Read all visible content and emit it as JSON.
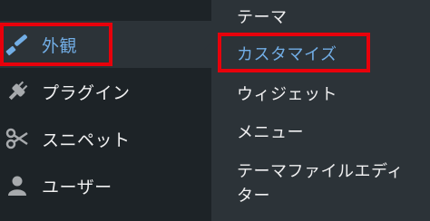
{
  "sidebar": {
    "items": [
      {
        "label": "外観",
        "icon": "paintbrush-icon",
        "active": true
      },
      {
        "label": "プラグイン",
        "icon": "plug-icon"
      },
      {
        "label": "スニペット",
        "icon": "scissors-icon"
      },
      {
        "label": "ユーザー",
        "icon": "user-icon"
      }
    ]
  },
  "submenu": {
    "items": [
      {
        "label": "テーマ"
      },
      {
        "label": "カスタマイズ",
        "current": true
      },
      {
        "label": "ウィジェット"
      },
      {
        "label": "メニュー"
      },
      {
        "label": "テーマファイルエディ"
      },
      {
        "label": "ター"
      }
    ]
  },
  "colors": {
    "sidebar_bg": "#1d2327",
    "submenu_bg": "#2c3338",
    "accent": "#72aee6",
    "highlight_box": "#e8000b"
  }
}
